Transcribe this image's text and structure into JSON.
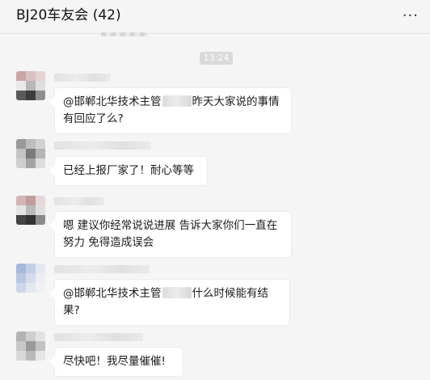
{
  "window": {
    "title": "BJ20车友会 (42)",
    "more_icon": "more-horizontal-icon"
  },
  "chat": {
    "timestamp": "13:24",
    "messages": [
      {
        "mention": "@邯郸北华技术主管",
        "text": "昨天大家说的事情有回应了么?"
      },
      {
        "text": "已经上报厂家了！耐心等等"
      },
      {
        "text": "嗯 建议你经常说说进展 告诉大家你们一直在努力 免得造成误会"
      },
      {
        "mention": "@邯郸北华技术主管",
        "text": "什么时候能有结果?"
      },
      {
        "text": "尽快吧！我尽量催催!"
      }
    ]
  },
  "colors": {
    "background": "#f5f5f5",
    "bubble": "#ffffff",
    "timestamp_pill": "#dadada"
  }
}
